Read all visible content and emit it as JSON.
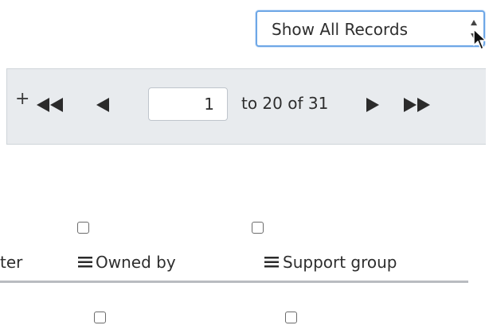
{
  "record_select": {
    "selected": "Show All Records"
  },
  "pager": {
    "partial_glyph": "+",
    "first_icon": "double-left-arrow-icon",
    "prev_icon": "left-arrow-icon",
    "next_icon": "right-arrow-icon",
    "last_icon": "double-right-arrow-icon",
    "current_page": "1",
    "range_text": "to 20 of 31"
  },
  "table": {
    "columns": [
      {
        "label": "ter"
      },
      {
        "label": "Owned by"
      },
      {
        "label": "Support group"
      }
    ]
  },
  "colors": {
    "select_border": "#6ea7e6",
    "pager_bg": "#e8ebee",
    "text": "#2e2e2e"
  }
}
